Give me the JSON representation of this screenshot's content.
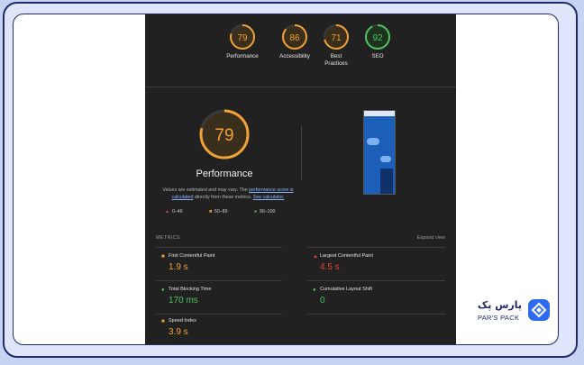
{
  "categories": [
    {
      "label": "Performance",
      "score": "79",
      "color": "#f1a136"
    },
    {
      "label": "Accessibility",
      "score": "86",
      "color": "#f1a136"
    },
    {
      "label": "Best\nPractices",
      "score": "71",
      "color": "#f1a136"
    },
    {
      "label": "SEO",
      "score": "92",
      "color": "#4fc25c"
    }
  ],
  "performance": {
    "score": "79",
    "title": "Performance",
    "note_prefix": "Values are estimated and may vary. The ",
    "note_link1": "performance score is calculated",
    "note_mid": " directly from these metrics. ",
    "note_link2": "See calculator.",
    "legend": [
      {
        "range": "0–49",
        "color": "#e4453b",
        "icon": "triangle-icon"
      },
      {
        "range": "50–89",
        "color": "#f1a136",
        "icon": "square-icon"
      },
      {
        "range": "90–100",
        "color": "#4fc25c",
        "icon": "circle-icon"
      }
    ]
  },
  "metrics": {
    "heading": "METRICS",
    "expand_label": "Expand view",
    "items": [
      {
        "name": "First Contentful Paint",
        "value": "1.9 s",
        "color": "#f1a136",
        "icon": "square-icon"
      },
      {
        "name": "Largest Contentful Paint",
        "value": "4.5 s",
        "color": "#e4453b",
        "icon": "triangle-icon"
      },
      {
        "name": "Total Blocking Time",
        "value": "170 ms",
        "color": "#4fc25c",
        "icon": "circle-icon"
      },
      {
        "name": "Cumulative Layout Shift",
        "value": "0",
        "color": "#4fc25c",
        "icon": "circle-icon"
      },
      {
        "name": "Speed Index",
        "value": "3.9 s",
        "color": "#f1a136",
        "icon": "square-icon"
      }
    ]
  },
  "logo": {
    "fa_text": "پارس پک",
    "en_text": "PAR'S PACK"
  }
}
